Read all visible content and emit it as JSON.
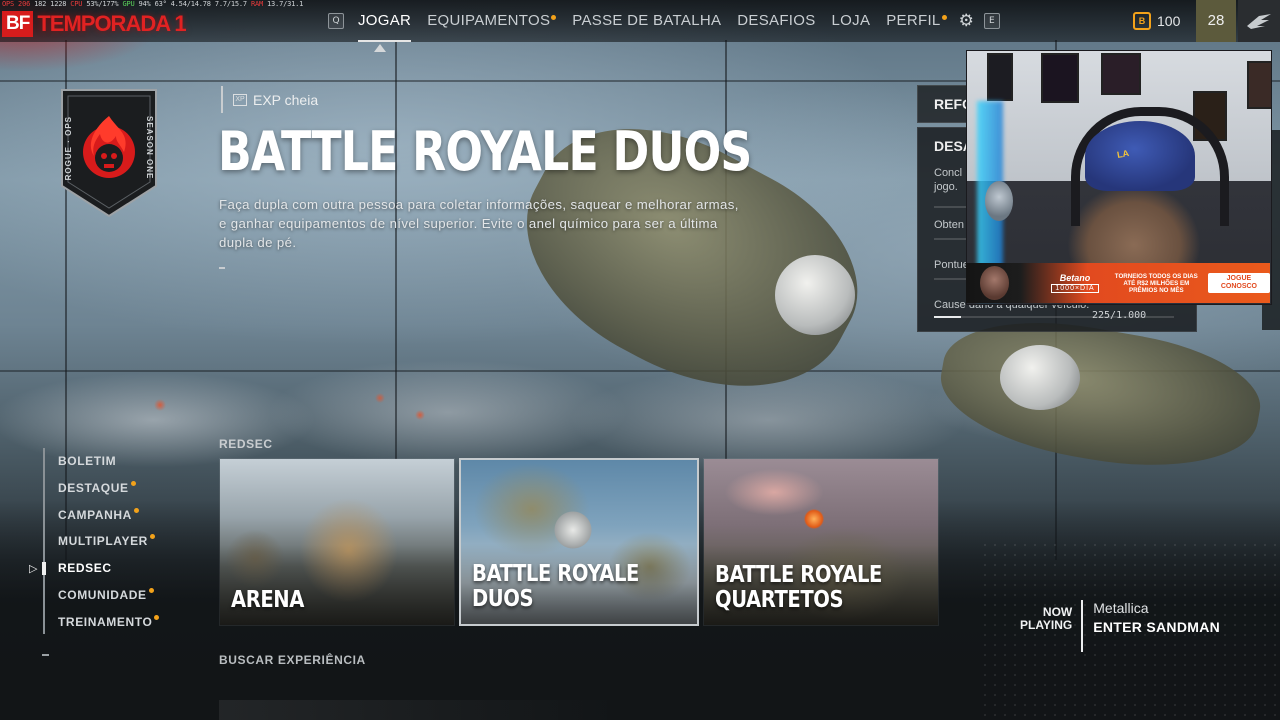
{
  "overlay_stats": {
    "fps": "OPS 206",
    "frametime": "182 1228",
    "cpu_label": "CPU",
    "cpu_value": "53%/177%",
    "gpu_label": "GPU",
    "gpu_value": "94%  63°",
    "vram": "4.54/14.78",
    "mem": "7.7/15.7",
    "ram_label": "RAM",
    "ram_value": "13.7/31.1"
  },
  "brand": {
    "logo": "BF",
    "season": "TEMPORADA 1"
  },
  "nav": {
    "left_key": "Q",
    "right_key": "E",
    "items": [
      {
        "label": "JOGAR",
        "active": true,
        "dot": false
      },
      {
        "label": "EQUIPAMENTOS",
        "active": false,
        "dot": true
      },
      {
        "label": "PASSE DE BATALHA",
        "active": false,
        "dot": false
      },
      {
        "label": "DESAFIOS",
        "active": false,
        "dot": false
      },
      {
        "label": "LOJA",
        "active": false,
        "dot": false
      },
      {
        "label": "PERFIL",
        "active": false,
        "dot": true
      }
    ]
  },
  "currency": {
    "icon": "B",
    "value": "100"
  },
  "player_level": "28",
  "season_badge": {
    "text_left": "ROGUE · OPS",
    "text_right": "SEASON ONE"
  },
  "mode": {
    "exp_chip": "EXP cheia",
    "title": "BATTLE ROYALE DUOS",
    "description": "Faça dupla com outra pessoa para coletar informações, saquear e melhorar armas, e ganhar equipamentos de nível superior. Evite o anel químico para ser a última dupla de pé."
  },
  "sidebar": {
    "items": [
      {
        "label": "BOLETIM",
        "dot": false,
        "active": false
      },
      {
        "label": "DESTAQUE",
        "dot": true,
        "active": false
      },
      {
        "label": "CAMPANHA",
        "dot": true,
        "active": false
      },
      {
        "label": "MULTIPLAYER",
        "dot": true,
        "active": false
      },
      {
        "label": "REDSEC",
        "dot": false,
        "active": true
      },
      {
        "label": "COMUNIDADE",
        "dot": true,
        "active": false
      },
      {
        "label": "TREINAMENTO",
        "dot": true,
        "active": false
      }
    ]
  },
  "section_label": "REDSEC",
  "cards": [
    {
      "title": "ARENA",
      "selected": false
    },
    {
      "title": "BATTLE ROYALE DUOS",
      "selected": true
    },
    {
      "title": "BATTLE ROYALE\nQUARTETOS",
      "selected": false
    }
  ],
  "search_label": "BUSCAR EXPERIÊNCIA",
  "now_playing": {
    "label_line1": "NOW",
    "label_line2": "PLAYING",
    "artist": "Metallica",
    "song": "ENTER SANDMAN"
  },
  "challenges": {
    "tab": "REFO",
    "title": "DESA",
    "items": [
      {
        "text": "Concl",
        "text2": "jogo."
      },
      {
        "text": "Obten"
      },
      {
        "text": "Pontue como suporte"
      },
      {
        "text": "Cause dano a qualquer veículo."
      }
    ],
    "progress": "225/1.000"
  },
  "sponsor": {
    "brand": "Betano",
    "code": "1000×DIA",
    "text": "TORNEIOS TODOS OS DIAS ATÉ R$2 MILHÕES EM PRÊMIOS NO MÊS",
    "cta": "JOGUE CONOSCO"
  },
  "webcam": {
    "cap_logo": "LA"
  }
}
